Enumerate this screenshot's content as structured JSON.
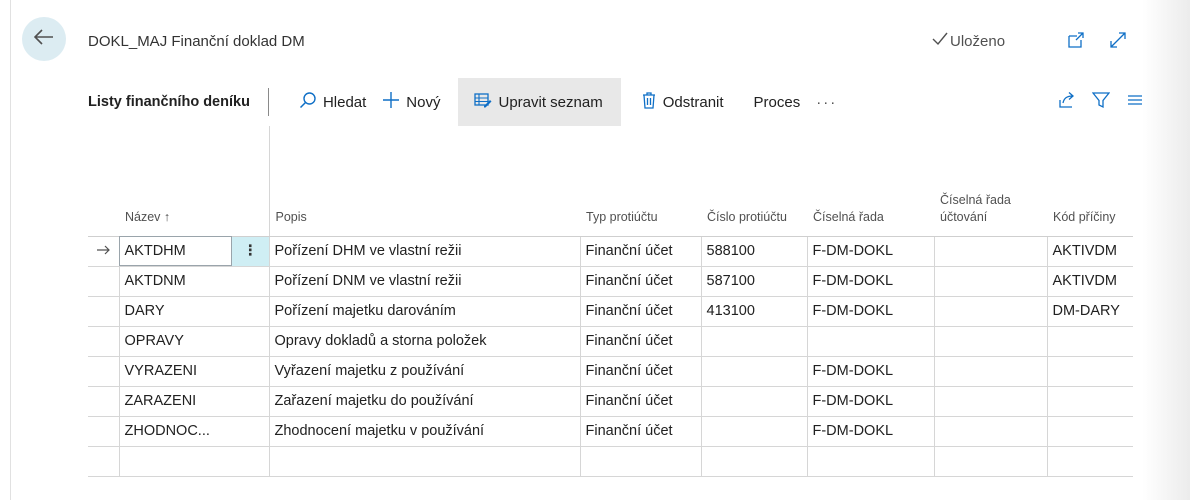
{
  "page": {
    "title": "DOKL_MAJ Finanční doklad DM",
    "saved_label": "Uloženo"
  },
  "actionbar": {
    "caption": "Listy finančního deníku",
    "search_label": "Hledat",
    "new_label": "Nový",
    "edit_list_label": "Upravit seznam",
    "delete_label": "Odstranit",
    "process_label": "Proces"
  },
  "grid": {
    "columns": {
      "name": "Název ↑",
      "description": "Popis",
      "bal_account_type": "Typ protiúčtu",
      "bal_account_no": "Číslo protiúčtu",
      "no_series": "Číselná řada",
      "posting_no_series": "Číselná řada účtování",
      "reason_code": "Kód příčiny"
    },
    "rows": [
      {
        "name": "AKTDHM",
        "description": "Pořízení DHM ve vlastní režii",
        "bal_account_type": "Finanční účet",
        "bal_account_no": "588100",
        "no_series": "F-DM-DOKL",
        "posting_no_series": "",
        "reason_code": "AKTIVDM"
      },
      {
        "name": "AKTDNM",
        "description": "Pořízení DNM ve vlastní režii",
        "bal_account_type": "Finanční účet",
        "bal_account_no": "587100",
        "no_series": "F-DM-DOKL",
        "posting_no_series": "",
        "reason_code": "AKTIVDM"
      },
      {
        "name": "DARY",
        "description": "Pořízení majetku darováním",
        "bal_account_type": "Finanční účet",
        "bal_account_no": "413100",
        "no_series": "F-DM-DOKL",
        "posting_no_series": "",
        "reason_code": "DM-DARY"
      },
      {
        "name": "OPRAVY",
        "description": "Opravy dokladů a storna položek",
        "bal_account_type": "Finanční účet",
        "bal_account_no": "",
        "no_series": "",
        "posting_no_series": "",
        "reason_code": ""
      },
      {
        "name": "VYRAZENI",
        "description": "Vyřazení majetku z používání",
        "bal_account_type": "Finanční účet",
        "bal_account_no": "",
        "no_series": "F-DM-DOKL",
        "posting_no_series": "",
        "reason_code": ""
      },
      {
        "name": "ZARAZENI",
        "description": "Zařazení majetku do používání",
        "bal_account_type": "Finanční účet",
        "bal_account_no": "",
        "no_series": "F-DM-DOKL",
        "posting_no_series": "",
        "reason_code": ""
      },
      {
        "name": "ZHODNOC...",
        "description": "Zhodnocení majetku v používání",
        "bal_account_type": "Finanční účet",
        "bal_account_no": "",
        "no_series": "F-DM-DOKL",
        "posting_no_series": "",
        "reason_code": ""
      }
    ]
  },
  "colors": {
    "accent": "#0f6fc6",
    "back_button_bg": "#dcecf2",
    "active_action_bg": "#e8e8e8",
    "row_action_bg": "#cfeef4"
  },
  "icons": {
    "back": "arrow-left-icon",
    "saved": "checkmark-icon",
    "open_new": "open-in-new-window-icon",
    "expand": "expand-icon",
    "search": "search-icon",
    "new": "plus-icon",
    "edit_list": "edit-list-icon",
    "delete": "trash-icon",
    "more": "more-icon",
    "share": "share-icon",
    "filter": "filter-icon",
    "list_view": "list-view-icon",
    "row_pointer": "arrow-right-icon",
    "row_actions": "vertical-dots-icon"
  }
}
